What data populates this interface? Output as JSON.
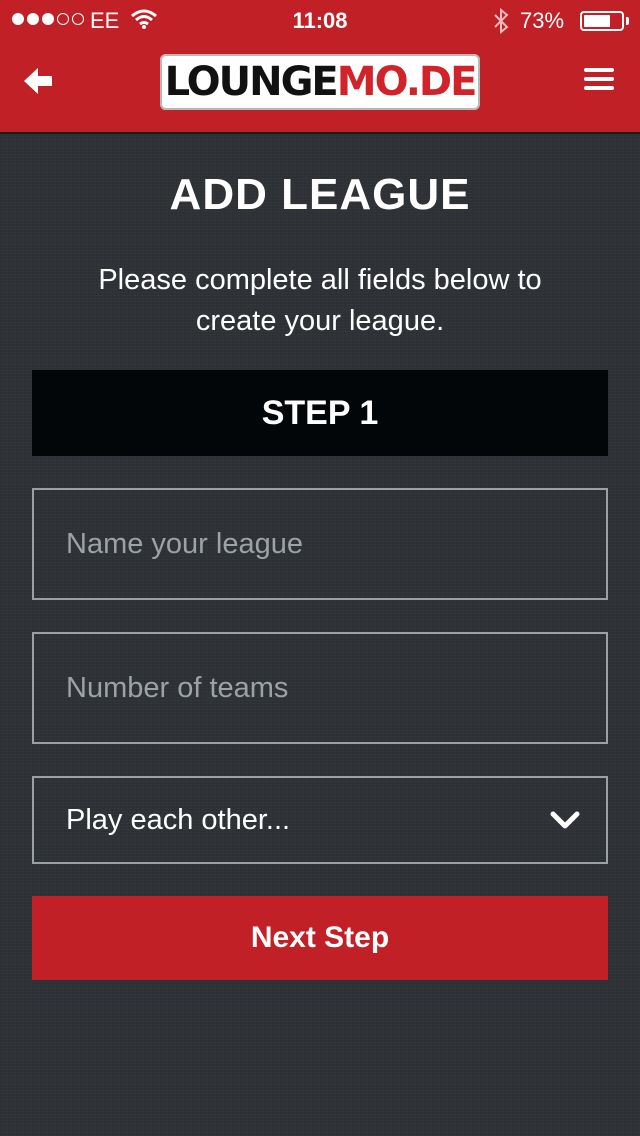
{
  "status_bar": {
    "carrier": "EE",
    "time": "11:08",
    "battery_percent": "73%",
    "battery_level": 0.73,
    "signal_bars": 3,
    "signal_total": 5
  },
  "nav": {
    "logo_part1": "LOUNGE",
    "logo_part2": "MO.DE",
    "back_icon": "arrow-left-icon",
    "menu_icon": "hamburger-icon"
  },
  "page": {
    "title": "ADD LEAGUE",
    "subtitle": "Please complete all fields below to create your league."
  },
  "form": {
    "step_label": "STEP 1",
    "league_name_placeholder": "Name your league",
    "league_name_value": "",
    "teams_placeholder": "Number of teams",
    "teams_value": "",
    "play_select_value": "Play each other...",
    "next_button_label": "Next Step"
  },
  "colors": {
    "brand_red": "#c12126",
    "background": "#2e3236",
    "step_bar": "#030608"
  }
}
